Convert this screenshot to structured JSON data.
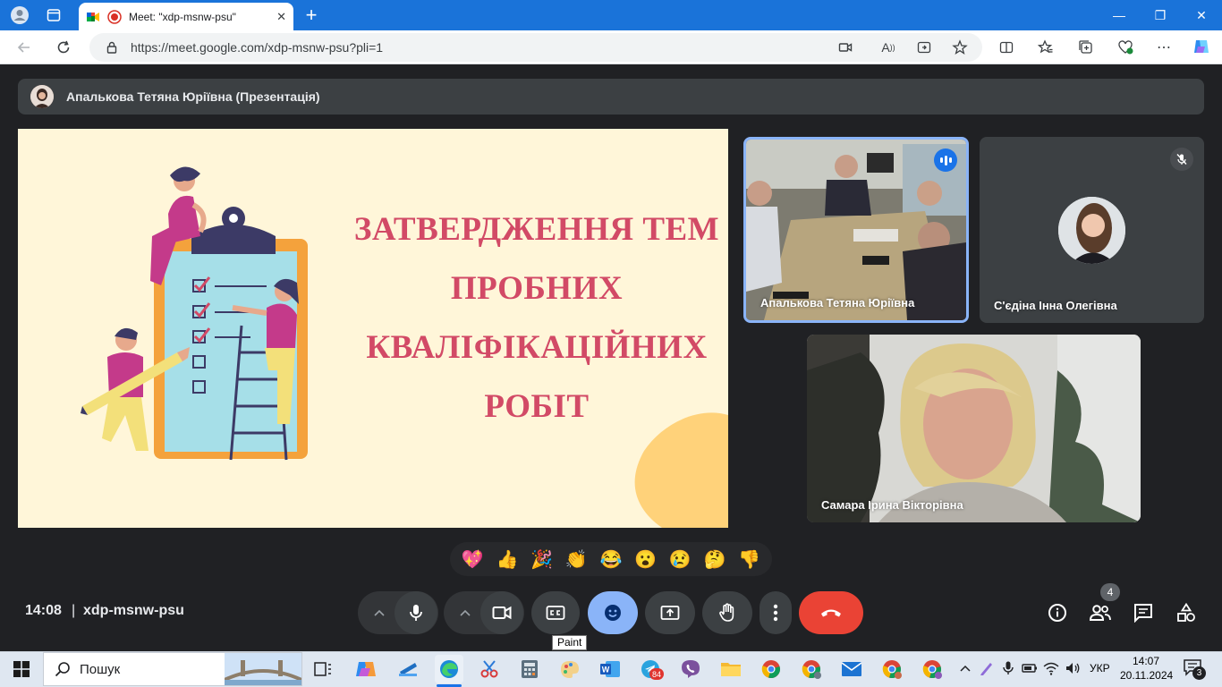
{
  "browser": {
    "tab_title": "Meet: \"xdp-msnw-psu\"",
    "url": "https://meet.google.com/xdp-msnw-psu?pli=1",
    "new_tab_symbol": "+",
    "close_tab_symbol": "✕",
    "minimize_symbol": "—",
    "restore_symbol": "❐",
    "close_window_symbol": "✕",
    "more_symbol": "⋯"
  },
  "presentation": {
    "banner_label": "Апалькова Тетяна Юріївна (Презентація)",
    "slide_title_lines": [
      "ЗАТВЕРДЖЕННЯ ТЕМ",
      "ПРОБНИХ",
      "КВАЛІФІКАЦІЙНИХ",
      "РОБІТ"
    ]
  },
  "participants": [
    {
      "name": "Апалькова Тетяна Юріївна",
      "state": "speaking"
    },
    {
      "name": "С'єдіна Інна Олегівна",
      "state": "muted"
    },
    {
      "name": "Самара Ірина Вікторівна",
      "state": "video"
    }
  ],
  "reactions": [
    "💖",
    "👍",
    "🎉",
    "👏",
    "😂",
    "😮",
    "😢",
    "🤔",
    "👎"
  ],
  "meeting": {
    "time": "14:08",
    "separator": "|",
    "code": "xdp-msnw-psu",
    "participants_count": "4",
    "tooltip": "Paint"
  },
  "taskbar": {
    "search_placeholder": "Пошук",
    "teams_badge": "84",
    "language": "УКР",
    "time": "14:07",
    "date": "20.11.2024",
    "notification_count": "3"
  },
  "colors": {
    "tab_strip": "#1a73d9",
    "meet_bg": "#202124",
    "control_bg": "#3c4043",
    "reactions_active": "#8ab4f8",
    "end_call": "#ea4335",
    "slide_title": "#d24a66",
    "slide_bg": "#fff6d9"
  }
}
